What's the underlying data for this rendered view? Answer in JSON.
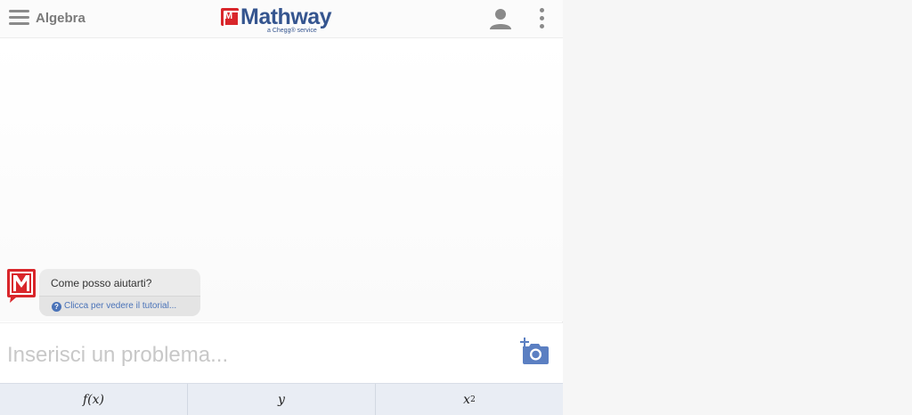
{
  "header": {
    "subject": "Algebra",
    "logo_text": "Mathway",
    "logo_tagline": "a Chegg® service"
  },
  "chat": {
    "bot_message": "Come posso aiutarti?",
    "tutorial_link": "Clicca per vedere il tutorial..."
  },
  "input": {
    "placeholder": "Inserisci un problema..."
  },
  "keyboard": {
    "keys": [
      {
        "label": "f(x)"
      },
      {
        "label": "y"
      },
      {
        "label": "x",
        "sup": "2"
      }
    ]
  },
  "colors": {
    "brand_blue": "#35558f",
    "brand_red": "#d9262b",
    "link_blue": "#4a73b8",
    "keyboard_bg": "#e9edf4"
  }
}
